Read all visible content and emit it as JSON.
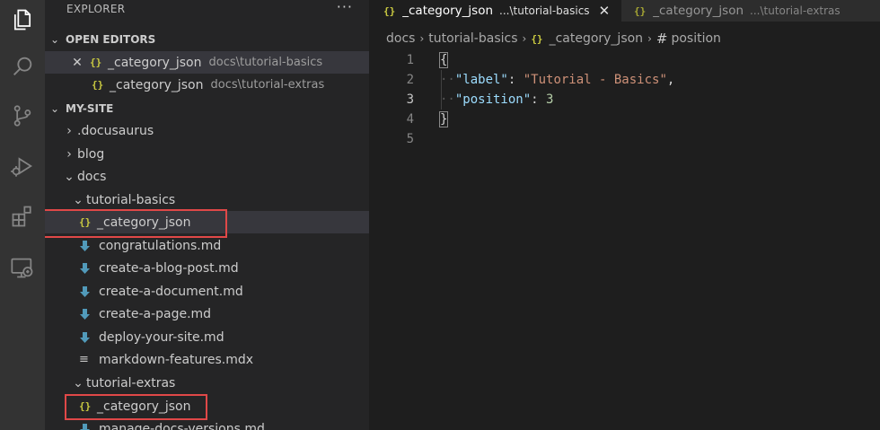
{
  "activity_bar": {
    "icons": [
      "explorer-icon",
      "search-icon",
      "source-control-icon",
      "run-debug-icon",
      "extensions-icon",
      "remote-explorer-icon"
    ]
  },
  "sidebar": {
    "title": "EXPLORER",
    "more": "···",
    "open_editors": {
      "header": "OPEN EDITORS",
      "items": [
        {
          "name": "_category_json",
          "desc": "docs\\tutorial-basics",
          "close": "✕"
        },
        {
          "name": "_category_json",
          "desc": "docs\\tutorial-extras"
        }
      ]
    },
    "tree": {
      "header": "MY-SITE",
      "items": [
        {
          "label": ".docusaurus",
          "kind": "folder-collapsed"
        },
        {
          "label": "blog",
          "kind": "folder-collapsed"
        },
        {
          "label": "docs",
          "kind": "folder-expanded"
        },
        {
          "label": "tutorial-basics",
          "kind": "folder-expanded"
        },
        {
          "label": "_category_json",
          "kind": "json"
        },
        {
          "label": "congratulations.md",
          "kind": "md"
        },
        {
          "label": "create-a-blog-post.md",
          "kind": "md"
        },
        {
          "label": "create-a-document.md",
          "kind": "md"
        },
        {
          "label": "create-a-page.md",
          "kind": "md"
        },
        {
          "label": "deploy-your-site.md",
          "kind": "md"
        },
        {
          "label": "markdown-features.mdx",
          "kind": "mdx"
        },
        {
          "label": "tutorial-extras",
          "kind": "folder-expanded"
        },
        {
          "label": "_category_json",
          "kind": "json"
        },
        {
          "label": "manage-docs-versions.md",
          "kind": "md"
        }
      ]
    }
  },
  "tabs": [
    {
      "icon": "{}",
      "label": "_category_json",
      "desc": "...\\tutorial-basics",
      "close": "✕"
    },
    {
      "icon": "{}",
      "label": "_category_json",
      "desc": "...\\tutorial-extras"
    }
  ],
  "breadcrumb": {
    "parts": [
      "docs",
      "tutorial-basics",
      "_category_json",
      "position"
    ],
    "separator": "›"
  },
  "code": {
    "line_numbers": [
      "1",
      "2",
      "3",
      "4",
      "5"
    ],
    "open_brace": "{",
    "close_brace": "}",
    "line2": {
      "key": "\"label\"",
      "colon": ": ",
      "value": "\"Tutorial - Basics\"",
      "comma": ","
    },
    "line3": {
      "key": "\"position\"",
      "colon": ": ",
      "value": "3"
    }
  },
  "colors": {
    "json_icon": "#cbcb41",
    "md_icon": "#519aba",
    "highlight_box": "#e04848",
    "key": "#9cdcfe",
    "string": "#ce9178",
    "number": "#b5cea8"
  }
}
